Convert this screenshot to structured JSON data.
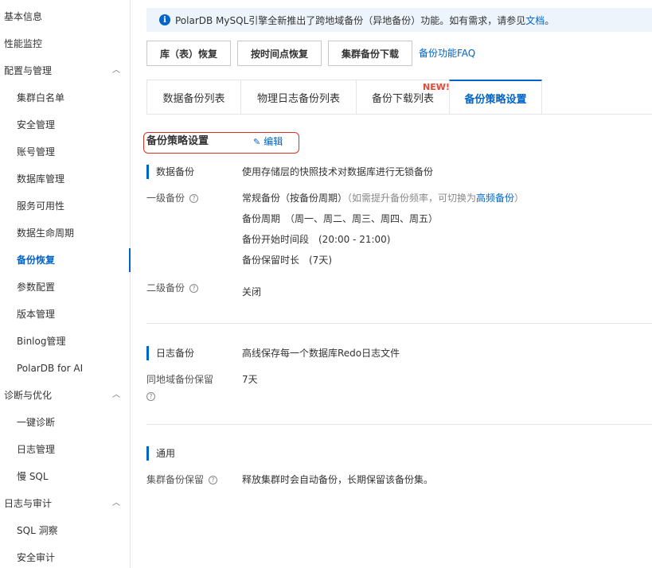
{
  "sidebar": {
    "items": [
      {
        "label": "基本信息",
        "level": 1
      },
      {
        "label": "性能监控",
        "level": 1
      },
      {
        "label": "配置与管理",
        "level": 1,
        "expandable": true
      },
      {
        "label": "集群白名单",
        "level": 2
      },
      {
        "label": "安全管理",
        "level": 2
      },
      {
        "label": "账号管理",
        "level": 2
      },
      {
        "label": "数据库管理",
        "level": 2
      },
      {
        "label": "服务可用性",
        "level": 2
      },
      {
        "label": "数据生命周期",
        "level": 2
      },
      {
        "label": "备份恢复",
        "level": 2,
        "active": true
      },
      {
        "label": "参数配置",
        "level": 2
      },
      {
        "label": "版本管理",
        "level": 2
      },
      {
        "label": "Binlog管理",
        "level": 2
      },
      {
        "label": "PolarDB for AI",
        "level": 2
      },
      {
        "label": "诊断与优化",
        "level": 1,
        "expandable": true
      },
      {
        "label": "一键诊断",
        "level": 2
      },
      {
        "label": "日志管理",
        "level": 2
      },
      {
        "label": "慢 SQL",
        "level": 2
      },
      {
        "label": "日志与审计",
        "level": 1,
        "expandable": true
      },
      {
        "label": "SQL 洞察",
        "level": 2
      },
      {
        "label": "安全审计",
        "level": 2
      }
    ]
  },
  "notice": {
    "text": "PolarDB MySQL引擎全新推出了跨地域备份（异地备份）功能。如有需求，请参见",
    "link": "文档",
    "end": "。"
  },
  "toolbar": {
    "restore_table": "库（表）恢复",
    "restore_time": "按时间点恢复",
    "cluster_download": "集群备份下载",
    "faq": "备份功能FAQ"
  },
  "tabs": [
    {
      "label": "数据备份列表"
    },
    {
      "label": "物理日志备份列表"
    },
    {
      "label": "备份下载列表",
      "badge": "NEW!"
    },
    {
      "label": "备份策略设置",
      "active": true
    }
  ],
  "policy": {
    "title": "备份策略设置",
    "edit": "编辑"
  },
  "data_backup": {
    "head": "数据备份",
    "desc": "使用存储层的快照技术对数据库进行无锁备份",
    "level1_label": "一级备份",
    "level1_mode": "常规备份（按备份周期）",
    "level1_hint": "（如需提升备份频率，可切换为",
    "level1_hint_link": "高频备份",
    "level1_hint_end": "）",
    "cycle": "备份周期　（周一、周二、周三、周四、周五）",
    "start_time": "备份开始时间段　(20:00 - 21:00)",
    "retention": "备份保留时长　(7天)",
    "level2_label": "二级备份",
    "level2_value": "关闭"
  },
  "log_backup": {
    "head": "日志备份",
    "desc": "高线保存每一个数据库Redo日志文件",
    "same_region_label": "同地域备份保留",
    "same_region_value": "7天"
  },
  "general": {
    "head": "通用",
    "cluster_label": "集群备份保留",
    "cluster_value": "释放集群时会自动备份，长期保留该备份集。"
  },
  "icons": {
    "info": "info-icon",
    "help": "help-icon",
    "edit": "pencil-icon",
    "chevron": "chevron-up-icon"
  },
  "colors": {
    "accent": "#0064c8",
    "highlight_border": "#d93026",
    "badge": "#e84738"
  }
}
